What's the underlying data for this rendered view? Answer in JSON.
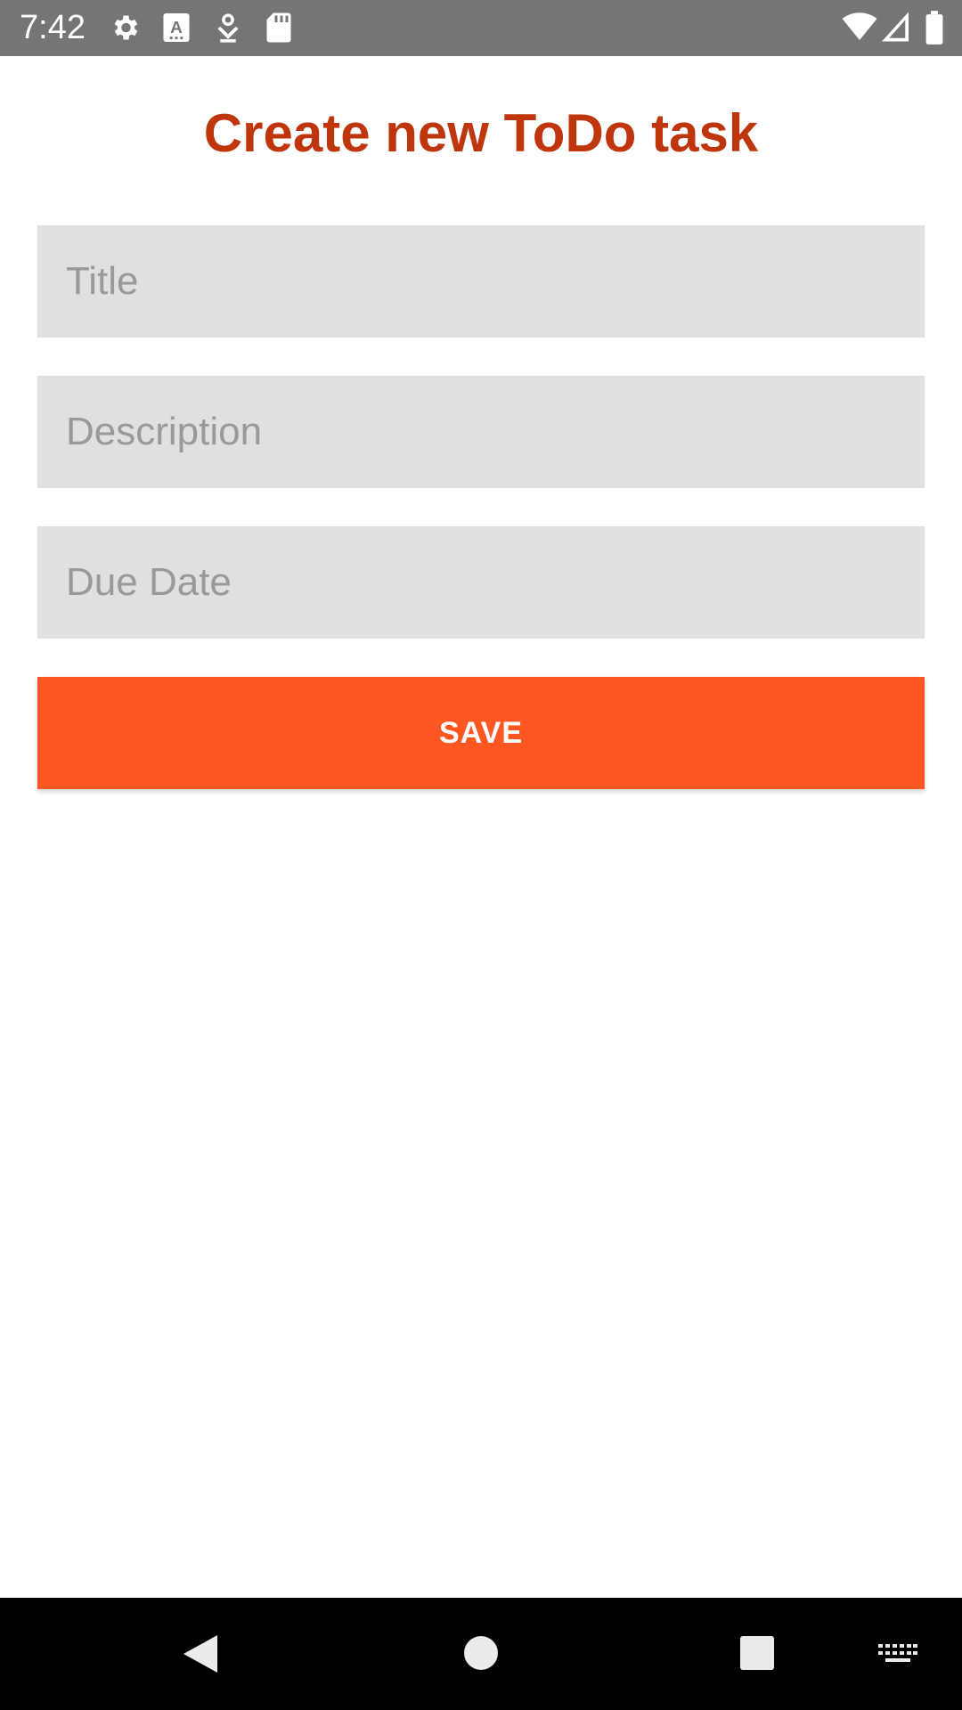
{
  "status_bar": {
    "time": "7:42",
    "left_icons": [
      "gear-icon",
      "a-app-icon",
      "download-icon",
      "sd-card-icon"
    ],
    "right_icons": [
      "wifi-icon",
      "signal-icon",
      "battery-icon"
    ]
  },
  "form": {
    "heading": "Create new ToDo task",
    "title_placeholder": "Title",
    "description_placeholder": "Description",
    "due_date_placeholder": "Due Date",
    "save_label": "SAVE"
  },
  "colors": {
    "heading": "#bf360c",
    "save_button": "#ff5722",
    "field_background": "#e0e0e0",
    "status_bar": "#757575",
    "nav_bar": "#000000"
  },
  "nav_bar": {
    "buttons": [
      "back-icon",
      "home-icon",
      "recents-icon",
      "keyboard-icon"
    ]
  }
}
